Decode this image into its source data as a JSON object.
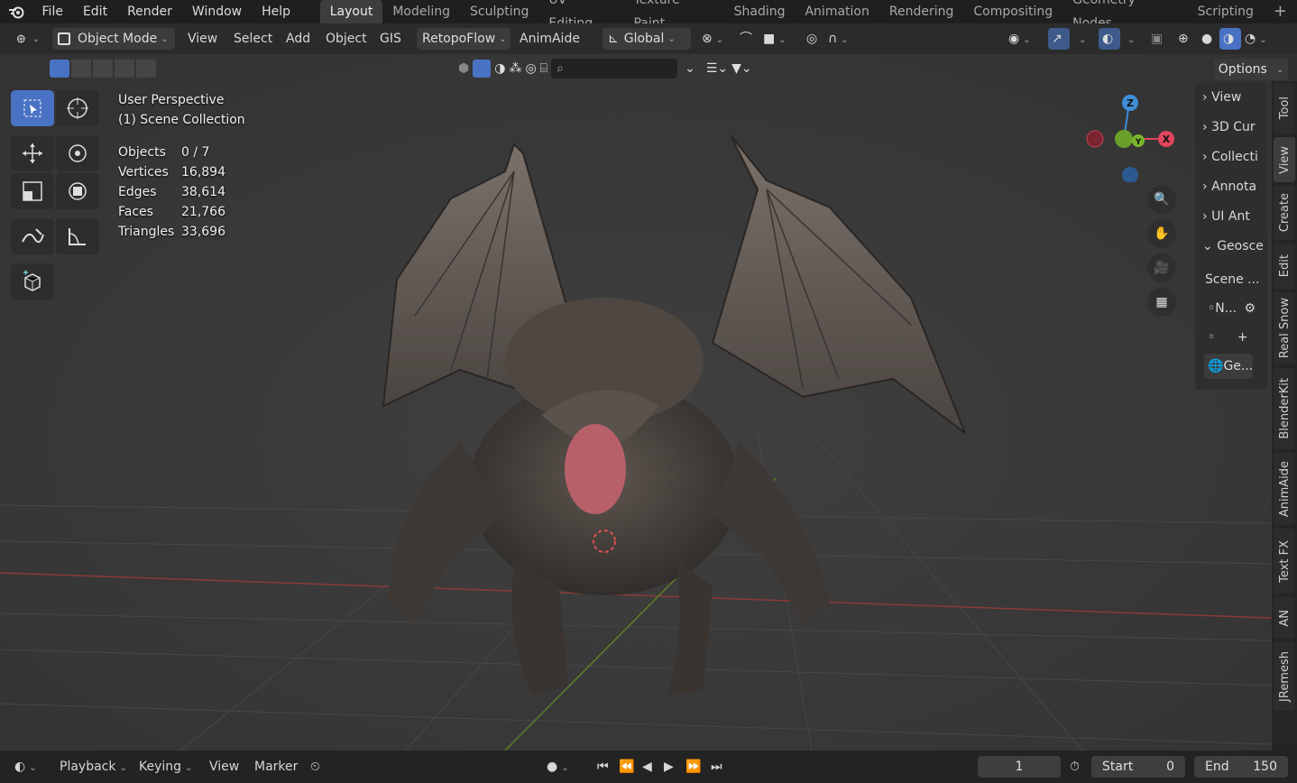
{
  "topbar": {
    "menus": [
      "File",
      "Edit",
      "Render",
      "Window",
      "Help"
    ],
    "workspaces": [
      "Layout",
      "Modeling",
      "Sculpting",
      "UV Editing",
      "Texture Paint",
      "Shading",
      "Animation",
      "Rendering",
      "Compositing",
      "Geometry Nodes",
      "Scripting",
      "+"
    ],
    "active_workspace": "Layout"
  },
  "header": {
    "mode": "Object Mode",
    "menus": [
      "View",
      "Select",
      "Add",
      "Object",
      "GIS"
    ],
    "addon1": "RetopoFlow",
    "addon2": "AnimAide",
    "transform_orientation": "Global",
    "options": "Options"
  },
  "overlay": {
    "perspective": "User Perspective",
    "collection": "(1) Scene Collection",
    "stats": [
      {
        "label": "Objects",
        "value": "0 / 7"
      },
      {
        "label": "Vertices",
        "value": "16,894"
      },
      {
        "label": "Edges",
        "value": "38,614"
      },
      {
        "label": "Faces",
        "value": "21,766"
      },
      {
        "label": "Triangles",
        "value": "33,696"
      }
    ]
  },
  "gizmo": {
    "x": "X",
    "y": "Y",
    "z": "Z"
  },
  "npanel": {
    "items": [
      "View",
      "3D Cur",
      "Collecti",
      "Annota",
      "UI Ant",
      "Geosce"
    ],
    "scene_label": "Scene ...",
    "row_n": "N...",
    "row_ge": "Ge..."
  },
  "vertical_tabs": [
    "Tool",
    "View",
    "Create",
    "Edit",
    "Real Snow",
    "BlenderKit",
    "AnimAide",
    "Text FX",
    "AN",
    "JRemesh"
  ],
  "active_vertical_tab": "View",
  "timeline": {
    "menus": [
      "Playback",
      "Keying",
      "View",
      "Marker"
    ],
    "current_frame": "1",
    "start_label": "Start",
    "start_value": "0",
    "end_label": "End",
    "end_value": "150"
  },
  "colors": {
    "accent": "#4a72c4",
    "x_axis": "#e0455a",
    "y_axis": "#7bb52c",
    "z_axis": "#3f8ed8"
  }
}
